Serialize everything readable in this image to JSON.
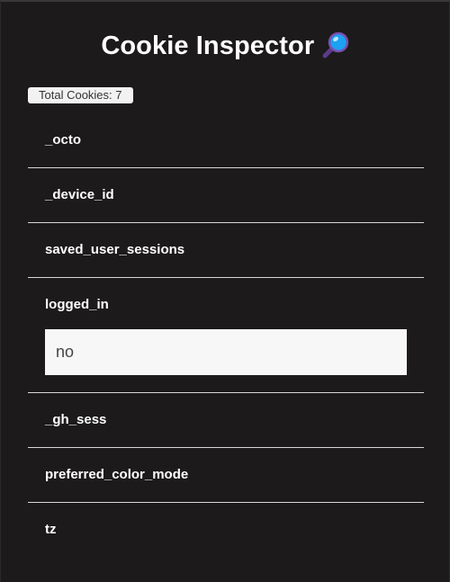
{
  "header": {
    "title": "Cookie Inspector",
    "icon": "magnifying-glass-icon"
  },
  "summary": {
    "total_label": "Total Cookies: 7"
  },
  "cookies": [
    {
      "name": "_octo",
      "expanded": false
    },
    {
      "name": "_device_id",
      "expanded": false
    },
    {
      "name": "saved_user_sessions",
      "expanded": false
    },
    {
      "name": "logged_in",
      "expanded": true,
      "value": "no"
    },
    {
      "name": "_gh_sess",
      "expanded": false
    },
    {
      "name": "preferred_color_mode",
      "expanded": false
    },
    {
      "name": "tz",
      "expanded": false
    }
  ],
  "colors": {
    "background": "#1c1a1a",
    "text": "#ffffff",
    "divider": "#d8d8d8",
    "value_field": "#f7f7f7",
    "icon_lens": "#1da1f2",
    "icon_handle": "#5b3a8c"
  }
}
